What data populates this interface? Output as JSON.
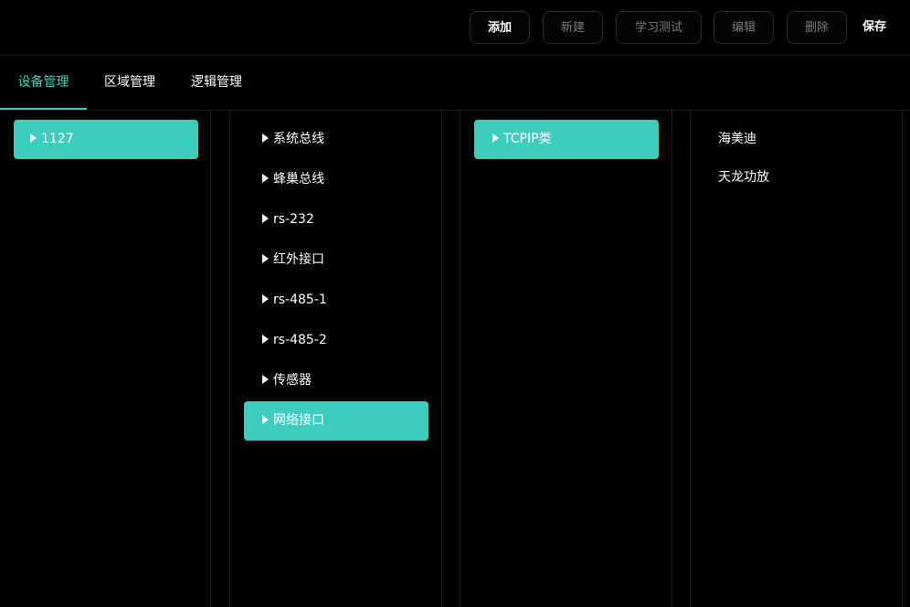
{
  "toolbar": {
    "buttons": [
      {
        "label": "添加",
        "enabled": true
      },
      {
        "label": "新建",
        "enabled": false
      },
      {
        "label": "学习测试",
        "enabled": false
      },
      {
        "label": "编辑",
        "enabled": false
      },
      {
        "label": "删除",
        "enabled": false
      }
    ],
    "save_label": "保存"
  },
  "tabs": [
    {
      "label": "设备管理",
      "active": true
    },
    {
      "label": "区域管理",
      "active": false
    },
    {
      "label": "逻辑管理",
      "active": false
    }
  ],
  "columns": {
    "devices": [
      {
        "label": "1127",
        "selected": true
      }
    ],
    "interfaces": [
      {
        "label": "系统总线",
        "selected": false
      },
      {
        "label": "蜂巢总线",
        "selected": false
      },
      {
        "label": "rs-232",
        "selected": false
      },
      {
        "label": "红外接口",
        "selected": false
      },
      {
        "label": "rs-485-1",
        "selected": false
      },
      {
        "label": "rs-485-2",
        "selected": false
      },
      {
        "label": "传感器",
        "selected": false
      },
      {
        "label": "网络接口",
        "selected": true
      }
    ],
    "categories": [
      {
        "label": "TCPIP类",
        "selected": true
      }
    ],
    "brands": [
      {
        "label": "海美迪"
      },
      {
        "label": "天龙功放"
      }
    ]
  },
  "colors": {
    "accent": "#3ecdbd",
    "background": "#000000",
    "divider": "#1c1c1c"
  }
}
